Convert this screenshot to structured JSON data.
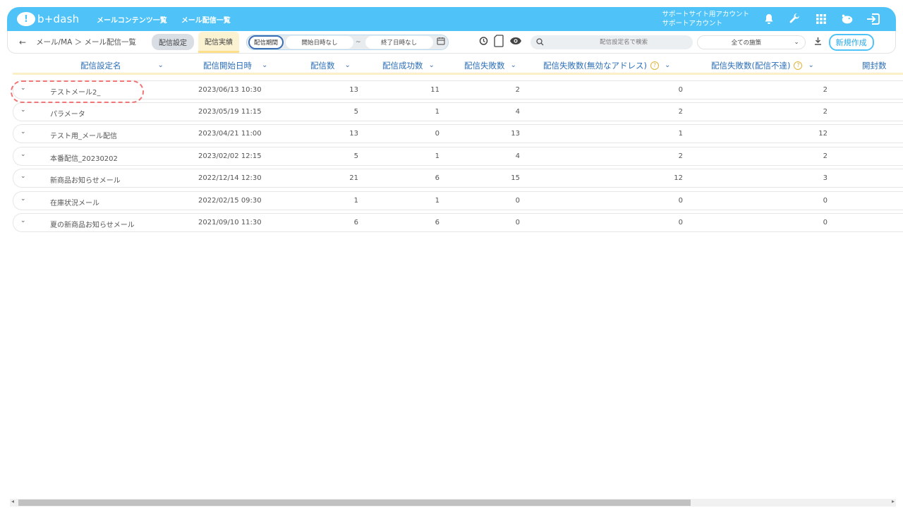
{
  "app": {
    "logo_text": "b+dash",
    "logo_mark": "!"
  },
  "topnav": [
    "メールコンテンツ一覧",
    "メール配信一覧"
  ],
  "account": {
    "line1": "サポートサイト用アカウント",
    "line2": "サポートアカウント"
  },
  "subbar": {
    "breadcrumb": "メール/MA ＞ メール配信一覧",
    "tab_settings": "配信設定",
    "tab_results": "配信実績",
    "period_label": "配信期間",
    "start_placeholder": "開始日時なし",
    "tilde": "~",
    "end_placeholder": "終了日時なし",
    "search_placeholder": "配信設定名で検索",
    "policy_select": "全ての施策",
    "new_button": "新規作成"
  },
  "table": {
    "columns": [
      "配信設定名",
      "配信開始日時",
      "配信数",
      "配信成功数",
      "配信失敗数",
      "配信失敗数(無効なアドレス)",
      "配信失敗数(配信不達)",
      "開封数"
    ],
    "rows": [
      {
        "name": "テストメール2_",
        "start": "2023/06/13 10:30",
        "sent": "13",
        "success": "11",
        "failed": "2",
        "invalid": "0",
        "bounce": "2"
      },
      {
        "name": "パラメータ",
        "start": "2023/05/19 11:15",
        "sent": "5",
        "success": "1",
        "failed": "4",
        "invalid": "2",
        "bounce": "2"
      },
      {
        "name": "テスト用_メール配信",
        "start": "2023/04/21 11:00",
        "sent": "13",
        "success": "0",
        "failed": "13",
        "invalid": "1",
        "bounce": "12"
      },
      {
        "name": "本番配信_20230202",
        "start": "2023/02/02 12:15",
        "sent": "5",
        "success": "1",
        "failed": "4",
        "invalid": "2",
        "bounce": "2"
      },
      {
        "name": "新商品お知らせメール",
        "start": "2022/12/14 12:30",
        "sent": "21",
        "success": "6",
        "failed": "15",
        "invalid": "12",
        "bounce": "3"
      },
      {
        "name": "在庫状況メール",
        "start": "2022/02/15 09:30",
        "sent": "1",
        "success": "1",
        "failed": "0",
        "invalid": "0",
        "bounce": "0"
      },
      {
        "name": "夏の新商品お知らせメール",
        "start": "2021/09/10 11:30",
        "sent": "6",
        "success": "6",
        "failed": "0",
        "invalid": "0",
        "bounce": "0"
      }
    ]
  },
  "colors": {
    "brand": "#4fc3f7",
    "header_text": "#2c6fb6",
    "highlight": "#f07777"
  },
  "icons": [
    "bell-icon",
    "wrench-icon",
    "grid-icon",
    "piggy-icon",
    "logout-icon",
    "history-icon",
    "document-icon",
    "eye-icon",
    "search-icon",
    "download-icon",
    "calendar-icon"
  ]
}
